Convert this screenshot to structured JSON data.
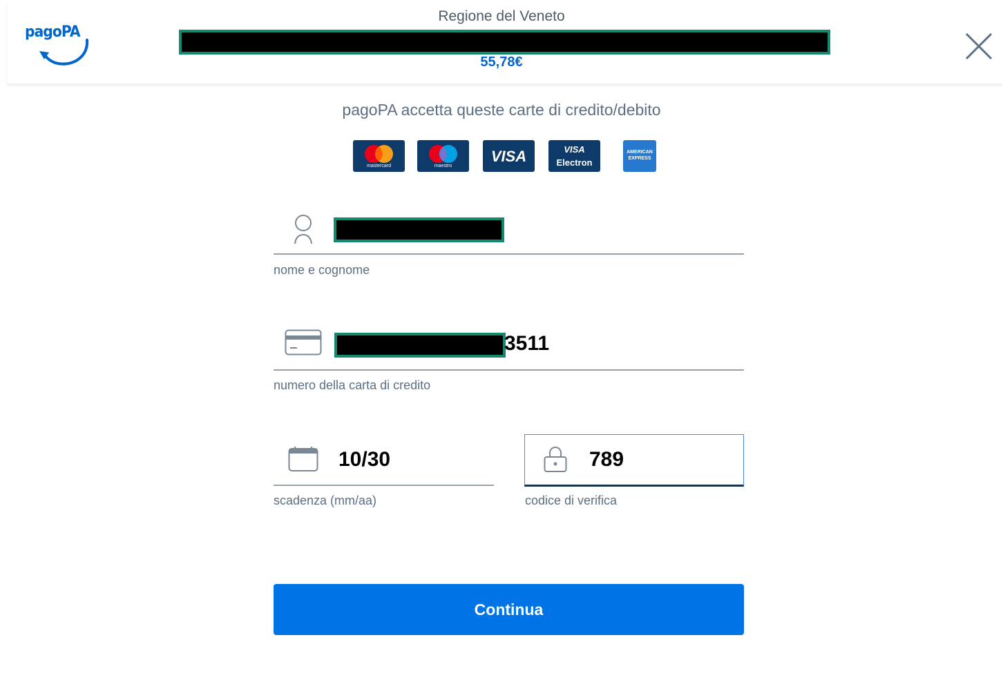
{
  "header": {
    "logo_text": "pagoPA",
    "organization": "Regione del Veneto",
    "amount": "55,78€"
  },
  "cards": {
    "caption": "pagoPA accetta queste carte di credito/debito",
    "brands": [
      {
        "name": "mastercard",
        "label": "mastercard"
      },
      {
        "name": "maestro",
        "label": "maestro"
      },
      {
        "name": "visa",
        "label": "VISA"
      },
      {
        "name": "visa-electron",
        "label_top": "VISA",
        "label_bottom": "Electron"
      },
      {
        "name": "american-express",
        "label_top": "AMERICAN",
        "label_bottom": "EXPRESS"
      }
    ]
  },
  "form": {
    "name_label": "nome e cognome",
    "card_number_label": "numero della carta di credito",
    "card_number_visible_suffix": "3511",
    "expiry_label": "scadenza (mm/aa)",
    "expiry_value": "10/30",
    "cvv_label": "codice di verifica",
    "cvv_value": "789",
    "submit_label": "Continua"
  },
  "colors": {
    "primary": "#0073e6",
    "brand_blue": "#0066cc",
    "text_muted": "#5c6f82",
    "redaction_border": "#138a6e"
  }
}
